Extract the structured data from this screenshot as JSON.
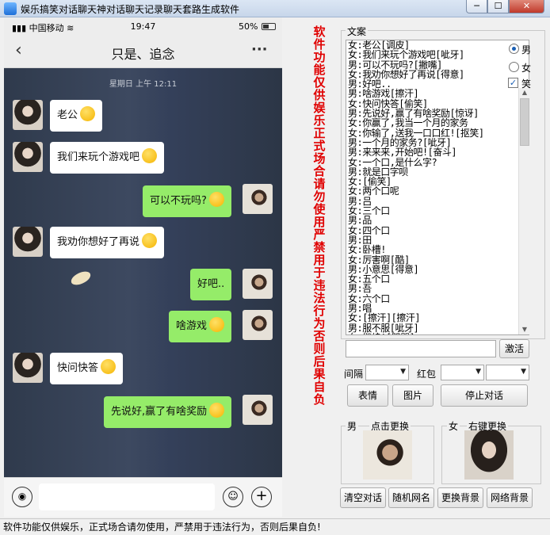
{
  "window": {
    "title": "娱乐搞笑对话聊天神对话聊天记录聊天套路生成软件",
    "min_glyph": "─",
    "max_glyph": "☐",
    "close_glyph": "✕"
  },
  "phone": {
    "carrier": "中国移动",
    "time": "19:47",
    "battery": "50%",
    "chat_title": "只是、追念",
    "timestamp": "星期日 上午 12:11",
    "messages": [
      {
        "side": "left",
        "text": "老公",
        "emoji": "surprised-emoji"
      },
      {
        "side": "left",
        "text": "我们来玩个游戏吧",
        "emoji": "grin-emoji"
      },
      {
        "side": "right",
        "text": "可以不玩吗?",
        "emoji": "sweat-emoji"
      },
      {
        "side": "left",
        "text": "我劝你想好了再说",
        "emoji": "cool-emoji"
      },
      {
        "side": "right",
        "text": "好吧..",
        "emoji": ""
      },
      {
        "side": "right",
        "text": "啥游戏",
        "emoji": "nervous-emoji"
      },
      {
        "side": "left",
        "text": "快问快答",
        "emoji": "thinking-emoji"
      },
      {
        "side": "right",
        "text": "先说好,赢了有啥奖励",
        "emoji": "nervous-emoji"
      }
    ]
  },
  "warning_vertical": "软件功能仅供娱乐 正式场合请勿使用 严禁用于违法行为 否则后果自负",
  "panel": {
    "group_label": "文案",
    "options": {
      "male": "男",
      "female": "女",
      "laugh": "笑",
      "laugh_checked": "✓"
    },
    "lines": [
      "女:老公[调皮]",
      "女:我们来玩个游戏吧[呲牙]",
      "男:可以不玩吗?[撇嘴]",
      "女:我劝你想好了再说[得意]",
      "男:好吧..",
      "男:啥游戏[擦汗]",
      "女:快问快答[偷笑]",
      "男:先说好,赢了有啥奖励[惊讶]",
      "女:你赢了,我当一个月的家务",
      "女:你输了,送我一口口红![抠笑]",
      "男:一个月的家务?[呲牙]",
      "男:来来来,开始吧![奋斗]",
      "女:一个口,是什么字?",
      "男:就是口字呗",
      "女:[偷笑]",
      "女:两个口呢",
      "男:吕",
      "女:三个口",
      "男:品",
      "女:四个口",
      "男:田",
      "女:卧槽!",
      "女:厉害啊[酷]",
      "男:小意思[得意]",
      "女:五个口",
      "男:吾",
      "女:六个口",
      "男:唱",
      "女:[擦汗][擦汗]",
      "男:服不服[呲牙]",
      "女:继续![咒骂]"
    ],
    "activate_button": "激活",
    "interval_label": "间隔",
    "redpacket_label": "红包",
    "emoji_button": "表情",
    "image_button": "图片",
    "stop_button": "停止对话",
    "male_label": "男",
    "male_change": "点击更换",
    "female_label": "女",
    "female_change": "右键更换",
    "clear_button": "清空对话",
    "random_name_button": "随机网名",
    "change_bg_button": "更换背景",
    "net_bg_button": "网络背景"
  },
  "status_text": "软件功能仅供娱乐，正式场合请勿使用，严禁用于违法行为，否则后果自负!"
}
